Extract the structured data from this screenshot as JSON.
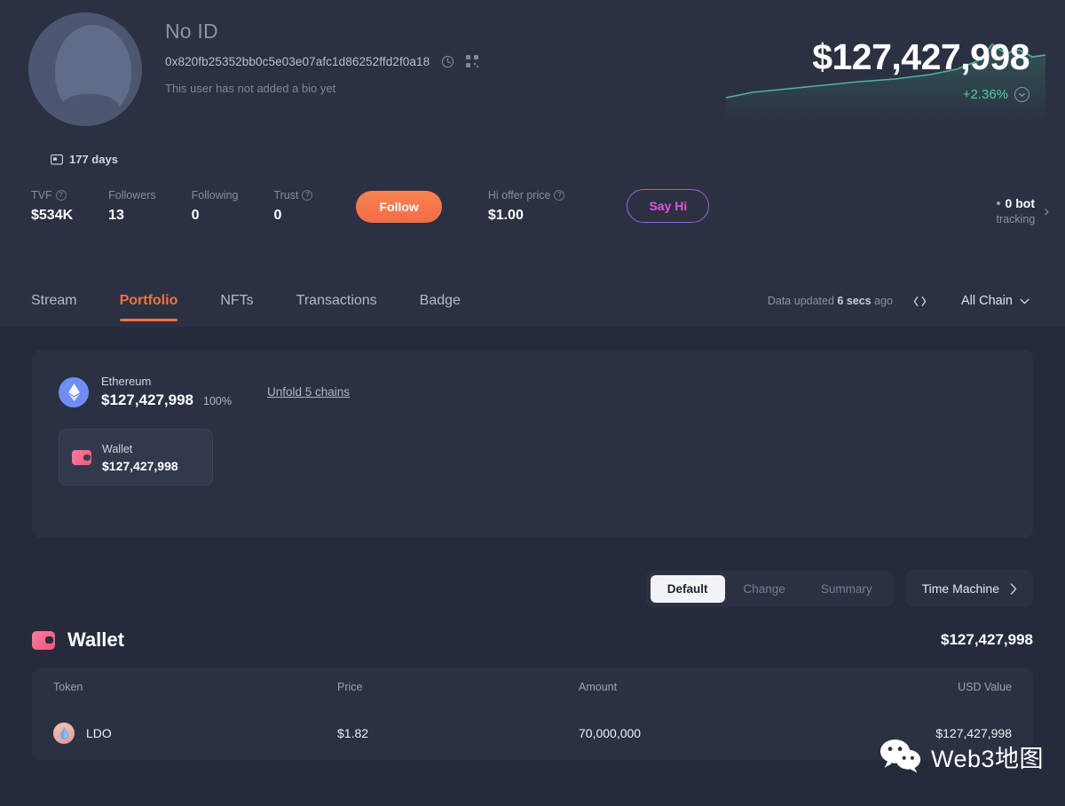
{
  "profile": {
    "display_name": "No ID",
    "address": "0x820fb25352bb0c5e03e07afc1d86252ffd2f0a18",
    "bio": "This user has not added a bio yet",
    "copy_icon": "copy-icon",
    "qr_icon": "qr-code-icon",
    "avatar_icon": "default-avatar-icon"
  },
  "value": {
    "total": "$127,427,998",
    "change": "+2.36%",
    "change_color": "#4fd1a5",
    "expand_icon": "chevron-down-circle-icon"
  },
  "days_badge": {
    "icon": "calendar-icon",
    "label": "177 days"
  },
  "stats": [
    {
      "label": "TVF",
      "value": "$534K",
      "has_help": true
    },
    {
      "label": "Followers",
      "value": "13",
      "has_help": false
    },
    {
      "label": "Following",
      "value": "0",
      "has_help": false
    },
    {
      "label": "Trust",
      "value": "0",
      "has_help": true
    }
  ],
  "actions": {
    "follow_label": "Follow",
    "follow_color": "#f26c47",
    "hi_price_label": "Hi offer price",
    "hi_price_value": "$1.00",
    "say_hi_label": "Say Hi",
    "say_hi_color": "#e056d8"
  },
  "bot": {
    "count_label": "0 bot",
    "sub_label": "tracking",
    "chevron": "chevron-right-icon"
  },
  "tabs": [
    {
      "label": "Stream",
      "active": false
    },
    {
      "label": "Portfolio",
      "active": true
    },
    {
      "label": "NFTs",
      "active": false
    },
    {
      "label": "Transactions",
      "active": false
    },
    {
      "label": "Badge",
      "active": false
    }
  ],
  "tabbar_right": {
    "updated_prefix": "Data updated",
    "updated_time": "6 secs",
    "updated_suffix": "ago",
    "refresh_icon": "refresh-icon",
    "chain_filter": "All Chain",
    "chain_caret": "chevron-down-icon"
  },
  "chain_card": {
    "icon": "ethereum-icon",
    "name": "Ethereum",
    "value": "$127,427,998",
    "percent": "100%",
    "unfold_label": "Unfold 5 chains",
    "wallet_chip": {
      "icon": "wallet-icon",
      "name": "Wallet",
      "value": "$127,427,998"
    }
  },
  "filters": {
    "segments": [
      {
        "label": "Default",
        "active": true
      },
      {
        "label": "Change",
        "active": false
      },
      {
        "label": "Summary",
        "active": false
      }
    ],
    "time_machine_label": "Time Machine",
    "time_machine_icon": "chevron-right-icon"
  },
  "wallet_section": {
    "icon": "wallet-icon",
    "title": "Wallet",
    "total": "$127,427,998",
    "columns": [
      "Token",
      "Price",
      "Amount",
      "USD Value"
    ],
    "rows": [
      {
        "icon": "ldo-token-icon",
        "token": "LDO",
        "price": "$1.82",
        "amount": "70,000,000",
        "usd_value": "$127,427,998"
      }
    ]
  },
  "watermark": {
    "icon": "wechat-icon",
    "text": "Web3地图"
  }
}
